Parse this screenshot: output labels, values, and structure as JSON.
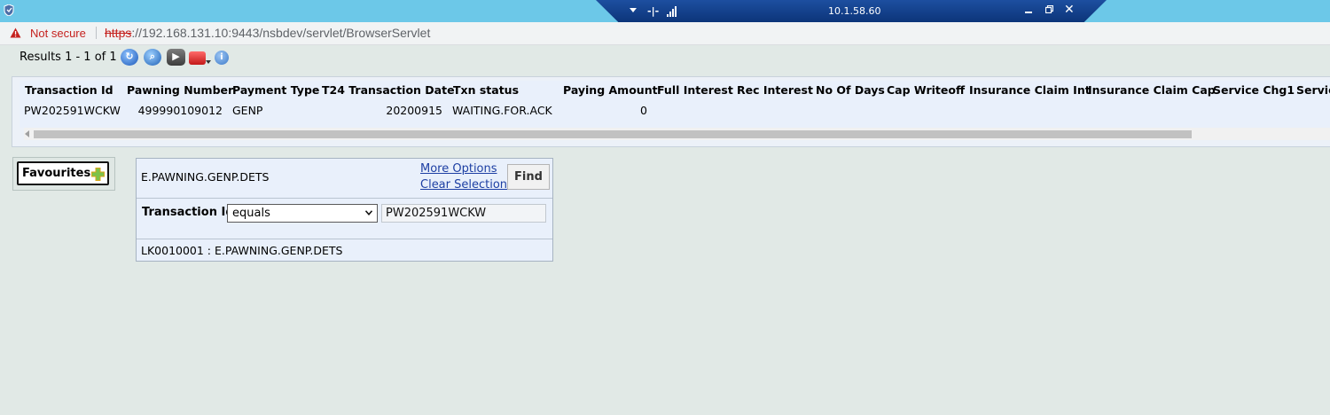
{
  "window": {
    "remote_ip": "10.1.58.60"
  },
  "address": {
    "security_label": "Not secure",
    "url_scheme": "https",
    "url_rest": "://192.168.131.10:9443/nsbdev/servlet/BrowserServlet"
  },
  "toolbar": {
    "results_text": "Results 1 - 1 of 1",
    "icons": [
      "refresh-icon",
      "search-icon",
      "play-icon",
      "toolbox-icon",
      "info-icon"
    ]
  },
  "grid": {
    "columns": [
      "Transaction Id",
      "Pawning Number",
      "Payment Type",
      "T24 Transaction Date",
      "Txn status",
      "Paying Amount",
      "Full Interest",
      "Rec Interest",
      "No Of Days",
      "Cap Writeoff",
      "Insurance Claim Int",
      "Insurance Claim Cap",
      "Service Chg1",
      "Servic"
    ],
    "rows": [
      [
        "PW202591WCKW",
        "499990109012",
        "GENP",
        "20200915",
        "WAITING.FOR.ACK",
        "0",
        "",
        "",
        "",
        "",
        "",
        "",
        "",
        ""
      ]
    ]
  },
  "favourites": {
    "label": "Favourites"
  },
  "find": {
    "enquiry_name": "E.PAWNING.GENP.DETS",
    "more_options": "More Options",
    "clear_selection": "Clear Selection",
    "find_button": "Find",
    "criteria_label": "Transaction Id",
    "operator": "equals",
    "value": "PW202591WCKW",
    "footer": "LK0010001 : E.PAWNING.GENP.DETS"
  }
}
